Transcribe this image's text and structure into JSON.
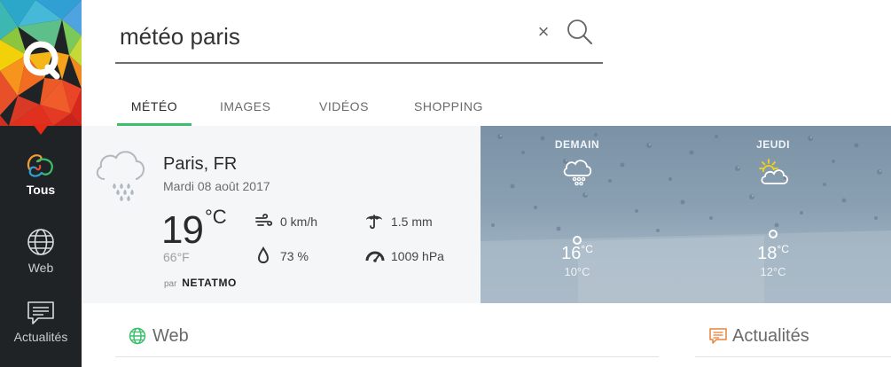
{
  "search": {
    "query": "météo paris",
    "clear_glyph": "×",
    "search_icon": "magnifier-icon"
  },
  "rail": {
    "logo_icon": "qwant-logo",
    "items": [
      {
        "label": "Tous",
        "icon": "qwant-all-icon",
        "active": true
      },
      {
        "label": "Web",
        "icon": "globe-icon",
        "active": false
      },
      {
        "label": "Actualités",
        "icon": "news-icon",
        "active": false
      }
    ]
  },
  "tabs": [
    {
      "label": "MÉTÉO",
      "active": true
    },
    {
      "label": "IMAGES",
      "active": false
    },
    {
      "label": "VIDÉOS",
      "active": false
    },
    {
      "label": "SHOPPING",
      "active": false
    }
  ],
  "weather": {
    "city": "Paris, FR",
    "date": "Mardi 08 août 2017",
    "temp_c": "19",
    "unit_c": "°C",
    "temp_f": "66°F",
    "icon": "cloud-rain-icon",
    "stats": {
      "wind": "0 km/h",
      "rain": "1.5 mm",
      "humidity": "73 %",
      "pressure": "1009 hPa"
    },
    "source_prefix": "par",
    "source_name": "NETATMO"
  },
  "forecast": [
    {
      "day": "DEMAIN",
      "icon": "cloud-rain-icon",
      "max": "16",
      "max_unit": "°C",
      "min": "10°C"
    },
    {
      "day": "JEUDI",
      "icon": "sun-cloud-icon",
      "max": "18",
      "max_unit": "°C",
      "min": "12°C"
    }
  ],
  "sections": {
    "web": "Web",
    "news": "Actualités"
  },
  "colors": {
    "accent_green": "#3bbf6a",
    "rail_bg": "#1f2326",
    "news_orange": "#e8833a",
    "web_green": "#3bbf6a"
  }
}
